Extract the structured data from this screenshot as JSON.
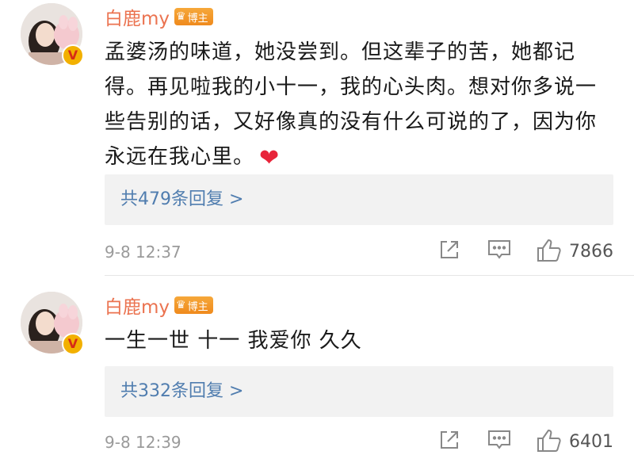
{
  "comments": [
    {
      "username": "白鹿my",
      "badge": "博主",
      "text": "孟婆汤的味道，她没尝到。但这辈子的苦，她都记得。再见啦我的小十一，我的心头肉。想对你多说一些告别的话，又好像真的没有什么可说的了，因为你永远在我心里。",
      "emoji": "heart",
      "replies": "共479条回复 >",
      "timestamp": "9-8 12:37",
      "likes": "7866"
    },
    {
      "username": "白鹿my",
      "badge": "博主",
      "text": "一生一世 十一 我爱你 久久",
      "replies": "共332条回复 >",
      "timestamp": "9-8 12:39",
      "likes": "6401"
    }
  ],
  "colors": {
    "username": "#eb7350",
    "link": "#507daf",
    "meta": "#9a9a9a",
    "verified": "#f2b000",
    "heart": "#e8243a"
  },
  "icons": [
    "share-icon",
    "comment-icon",
    "like-icon",
    "verified-icon",
    "crown-icon"
  ]
}
